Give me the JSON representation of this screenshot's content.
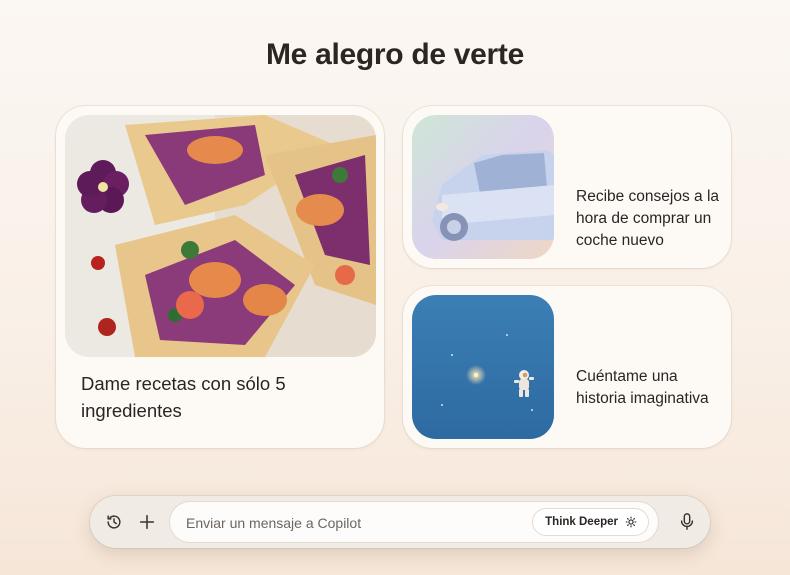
{
  "greeting": "Me alegro de verte",
  "cards": [
    {
      "label": "Dame recetas con sólo 5 ingredientes",
      "image": "tacos-photo"
    },
    {
      "label": "Recibe consejos a la hora de comprar un coche nuevo",
      "image": "car-illustration"
    },
    {
      "label": "Cuéntame una historia imaginativa",
      "image": "astronaut-in-space"
    }
  ],
  "composer": {
    "placeholder": "Enviar un mensaje a Copilot",
    "value": "",
    "think_deeper_label": "Think Deeper",
    "icons": [
      "history-icon",
      "plus-icon",
      "think-deeper-icon",
      "microphone-icon"
    ]
  }
}
